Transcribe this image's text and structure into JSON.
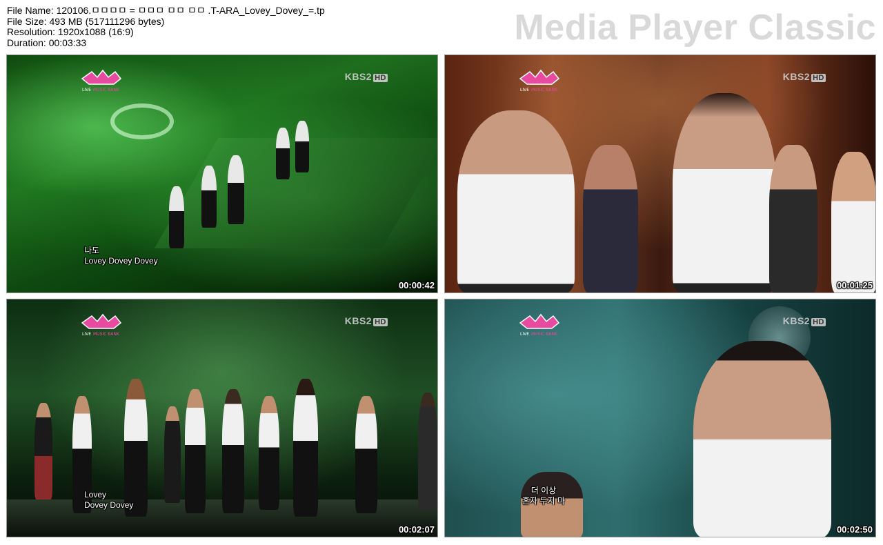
{
  "file_info": {
    "file_name": "File Name: 120106.ㅁㅁㅁㅁ = ㅁㅁㅁ ㅁㅁ ㅁㅁ .T-ARA_Lovey_Dovey_=.tp",
    "file_size": "File Size: 493 MB (517111296 bytes)",
    "resolution": "Resolution: 1920x1088 (16:9)",
    "duration": "Duration: 00:03:33"
  },
  "brand": "Media Player Classic",
  "thumbnails": [
    {
      "timestamp": "00:00:42",
      "channel": "KBS2",
      "channel_hd": "HD",
      "subtitle": [
        "나도",
        "Lovey Dovey Dovey"
      ]
    },
    {
      "timestamp": "00:01:25",
      "channel": "KBS2",
      "channel_hd": "HD",
      "subtitle": []
    },
    {
      "timestamp": "00:02:07",
      "channel": "KBS2",
      "channel_hd": "HD",
      "subtitle": [
        "Lovey",
        "Dovey Dovey"
      ]
    },
    {
      "timestamp": "00:02:50",
      "channel": "KBS2",
      "channel_hd": "HD",
      "subtitle": [
        "더 이상",
        "혼자 두지 마"
      ]
    }
  ],
  "show_logo": {
    "line1": "LIVE",
    "line2": "MUSIC BANK"
  },
  "colors": {
    "brand_text": "#d9d9d9",
    "frame_border": "#9a9a9a",
    "timestamp": "#ffffff"
  }
}
